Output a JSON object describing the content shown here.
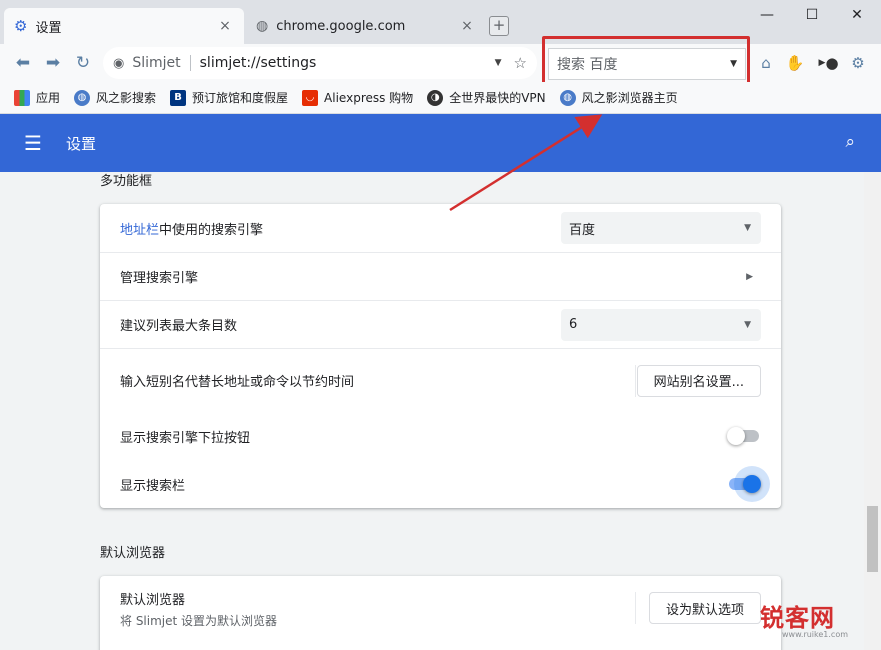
{
  "window": {
    "controls": {
      "minimize": "—",
      "maximize": "☐",
      "close": "✕"
    }
  },
  "tabs": [
    {
      "title": "设置",
      "icon": "gear-icon",
      "close": "×"
    },
    {
      "title": "chrome.google.com",
      "icon": "globe-icon",
      "close": "×"
    }
  ],
  "newtab": {
    "label": "+"
  },
  "toolbar": {
    "site_name": "Slimjet",
    "url": "slimjet://settings",
    "dropdown_glyph": "▼",
    "star_glyph": "☆",
    "search_box_text": "搜索 百度",
    "search_dropdown_glyph": "▼"
  },
  "bookmarks": [
    {
      "label": "应用",
      "icon": "apps-icon"
    },
    {
      "label": "风之影搜索",
      "icon": "globe-icon"
    },
    {
      "label": "预订旅馆和度假屋",
      "icon": "booking-icon"
    },
    {
      "label": "Aliexpress 购物",
      "icon": "aliexpress-icon"
    },
    {
      "label": "全世界最快的VPN",
      "icon": "vpn-icon"
    },
    {
      "label": "风之影浏览器主页",
      "icon": "globe-icon"
    }
  ],
  "header": {
    "title": "设置",
    "menu_glyph": "☰",
    "search_glyph": "⌕"
  },
  "sections": {
    "omnibox": {
      "title": "多功能框",
      "rows": {
        "engine": {
          "link": "地址栏",
          "label": "中使用的搜索引擎",
          "value": "百度"
        },
        "manage": {
          "label": "管理搜索引擎",
          "arrow": "▶"
        },
        "suggest": {
          "label": "建议列表最大条目数",
          "value": "6"
        },
        "alias": {
          "label": "输入短别名代替长地址或命令以节约时间",
          "button": "网站别名设置..."
        },
        "dropdown_btn": {
          "label": "显示搜索引擎下拉按钮",
          "state": "off"
        },
        "searchbar": {
          "label": "显示搜索栏",
          "state": "on"
        }
      }
    },
    "default_browser": {
      "title": "默认浏览器",
      "row": {
        "label": "默认浏览器",
        "sub": "将 Slimjet 设置为默认浏览器",
        "button": "设为默认选项"
      }
    }
  },
  "colors": {
    "header_blue": "#3367d6",
    "highlight_red": "#d32f2f",
    "toggle_on": "#1a73e8"
  },
  "watermark": {
    "text": "锐客网",
    "url": "www.ruike1.com"
  }
}
